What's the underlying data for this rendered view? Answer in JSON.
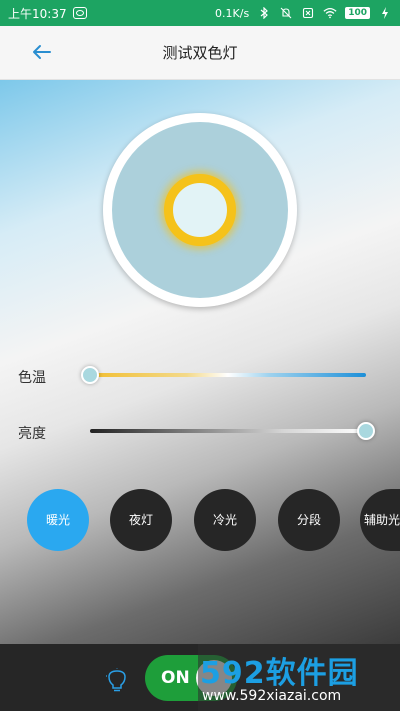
{
  "status_bar": {
    "time": "上午10:37",
    "network_speed": "0.1K/s",
    "battery": "100",
    "icons": [
      "message-icon",
      "bluetooth-icon",
      "mute-icon",
      "no-sim-icon",
      "wifi-icon",
      "battery-icon",
      "charging-icon"
    ]
  },
  "app_bar": {
    "title": "测试双色灯",
    "back_icon": "arrow-left-icon"
  },
  "lamp": {
    "outer_color": "#ffffff",
    "inner_color": "#acd0db",
    "ring_color": "#f5c21a",
    "center_color": "#e2f3f6"
  },
  "sliders": {
    "color_temperature": {
      "label": "色温",
      "value_fraction": 0.0
    },
    "brightness": {
      "label": "亮度",
      "value_fraction": 1.0
    }
  },
  "modes": [
    {
      "label": "暖光",
      "active": true
    },
    {
      "label": "夜灯",
      "active": false
    },
    {
      "label": "冷光",
      "active": false
    },
    {
      "label": "分段",
      "active": false
    },
    {
      "label": "辅助光",
      "active": false
    }
  ],
  "bottom_bar": {
    "bulb_icon": "lightbulb-icon",
    "power_label": "ON",
    "power_on": true
  },
  "watermark": {
    "line1": "592软件园",
    "line2": "www.592xiazai.com"
  },
  "colors": {
    "status_bar": "#1da462",
    "accent_blue": "#2aa8f0",
    "toggle_green": "#1e9e3a",
    "mode_dark": "#262626"
  }
}
